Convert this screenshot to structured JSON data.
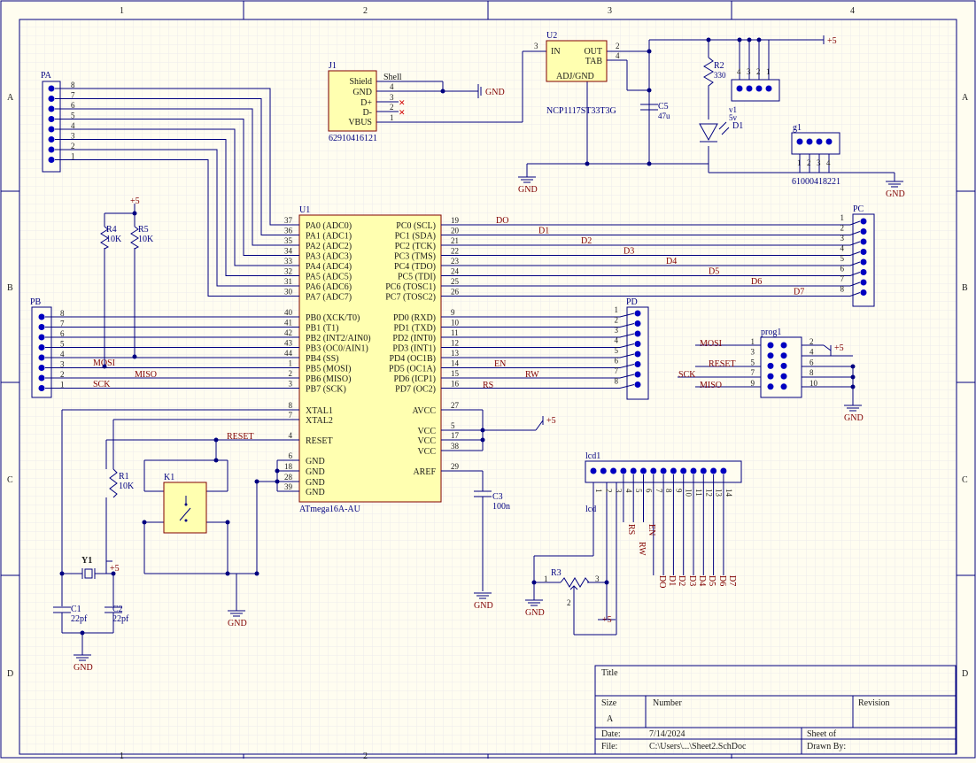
{
  "colors": {
    "wire": "#000080",
    "text": "#000080",
    "netlabel": "#800000",
    "chipfill": "#ffffb0",
    "chipstroke": "#800000",
    "grid": "#e8e8e8",
    "paper": "#fffdf0"
  },
  "border": {
    "cols": [
      "1",
      "2",
      "3",
      "4"
    ],
    "rows": [
      "A",
      "B",
      "C",
      "D"
    ]
  },
  "pa": {
    "ref": "PA",
    "pins": [
      "8",
      "7",
      "6",
      "5",
      "4",
      "3",
      "2",
      "1"
    ]
  },
  "pb": {
    "ref": "PB",
    "pins": [
      "8",
      "7",
      "6",
      "5",
      "4",
      "3",
      "2",
      "1"
    ],
    "nets": {
      "mosi": "MOSI",
      "miso": "MISO",
      "sck": "SCK"
    }
  },
  "pc": {
    "ref": "PC",
    "pins": [
      "1",
      "2",
      "3",
      "4",
      "5",
      "6",
      "7",
      "8"
    ],
    "nets": [
      "DO",
      "D1",
      "D2",
      "D3",
      "D4",
      "D5",
      "D6",
      "D7"
    ]
  },
  "pd": {
    "ref": "PD",
    "pins": [
      "1",
      "2",
      "3",
      "4",
      "5",
      "6",
      "7",
      "8"
    ],
    "nets": {
      "en": "EN",
      "rw": "RW",
      "rs": "RS"
    }
  },
  "u1": {
    "ref": "U1",
    "part": "ATmega16A-AU",
    "left_pa": [
      {
        "num": "37",
        "label": "PA0 (ADC0)"
      },
      {
        "num": "36",
        "label": "PA1 (ADC1)"
      },
      {
        "num": "35",
        "label": "PA2 (ADC2)"
      },
      {
        "num": "34",
        "label": "PA3 (ADC3)"
      },
      {
        "num": "33",
        "label": "PA4 (ADC4)"
      },
      {
        "num": "32",
        "label": "PA5 (ADC5)"
      },
      {
        "num": "31",
        "label": "PA6 (ADC6)"
      },
      {
        "num": "30",
        "label": "PA7 (ADC7)"
      }
    ],
    "left_pb": [
      {
        "num": "40",
        "label": "PB0 (XCK/T0)"
      },
      {
        "num": "41",
        "label": "PB1 (T1)"
      },
      {
        "num": "42",
        "label": "PB2 (INT2/AIN0)"
      },
      {
        "num": "43",
        "label": "PB3 (OC0/AIN1)"
      },
      {
        "num": "44",
        "label": "PB4 (SS)"
      },
      {
        "num": "1",
        "label": "PB5 (MOSI)"
      },
      {
        "num": "2",
        "label": "PB6 (MISO)"
      },
      {
        "num": "3",
        "label": "PB7 (SCK)"
      }
    ],
    "left_misc": [
      {
        "num": "8",
        "label": "XTAL1"
      },
      {
        "num": "7",
        "label": "XTAL2"
      },
      {
        "num": "4",
        "label": "RESET"
      },
      {
        "num": "6",
        "label": "GND"
      },
      {
        "num": "18",
        "label": "GND"
      },
      {
        "num": "28",
        "label": "GND"
      },
      {
        "num": "39",
        "label": "GND"
      }
    ],
    "right_pc": [
      {
        "num": "19",
        "label": "PC0 (SCL)"
      },
      {
        "num": "20",
        "label": "PC1 (SDA)"
      },
      {
        "num": "21",
        "label": "PC2 (TCK)"
      },
      {
        "num": "22",
        "label": "PC3 (TMS)"
      },
      {
        "num": "23",
        "label": "PC4 (TDO)"
      },
      {
        "num": "24",
        "label": "PC5 (TDI)"
      },
      {
        "num": "25",
        "label": "PC6 (TOSC1)"
      },
      {
        "num": "26",
        "label": "PC7 (TOSC2)"
      }
    ],
    "right_pd": [
      {
        "num": "9",
        "label": "PD0 (RXD)"
      },
      {
        "num": "10",
        "label": "PD1 (TXD)"
      },
      {
        "num": "11",
        "label": "PD2 (INT0)"
      },
      {
        "num": "12",
        "label": "PD3 (INT1)"
      },
      {
        "num": "13",
        "label": "PD4 (OC1B)"
      },
      {
        "num": "14",
        "label": "PD5 (OC1A)"
      },
      {
        "num": "15",
        "label": "PD6 (ICP1)"
      },
      {
        "num": "16",
        "label": "PD7 (OC2)"
      }
    ],
    "right_misc": [
      {
        "num": "27",
        "label": "AVCC"
      },
      {
        "num": "5",
        "label": "VCC"
      },
      {
        "num": "17",
        "label": "VCC"
      },
      {
        "num": "38",
        "label": "VCC"
      },
      {
        "num": "29",
        "label": "AREF"
      }
    ]
  },
  "j1": {
    "ref": "J1",
    "part": "62910416121",
    "pins": [
      {
        "label": "Shield",
        "num": "4"
      },
      {
        "label": "GND",
        "num": "3"
      },
      {
        "label": "D+",
        "num": "2"
      },
      {
        "label": "D-",
        "num": "1"
      },
      {
        "label": "VBUS",
        "num": ""
      }
    ],
    "shell": "Shell"
  },
  "u2": {
    "ref": "U2",
    "part": "NCP1117ST33T3G",
    "in": "IN",
    "out": "OUT",
    "tab": "TAB",
    "adj": "ADJ/GND",
    "pin_in": "3",
    "pin_out": "2",
    "pin_tab": "4",
    "pin_adj": "1"
  },
  "c5": {
    "ref": "C5",
    "value": "47u"
  },
  "r2": {
    "ref": "R2",
    "value": "330"
  },
  "d1": {
    "ref": "D1",
    "value": "v1",
    "color": "5v"
  },
  "g1": {
    "ref": "g1",
    "part": "61000418221",
    "pins": [
      "1",
      "2",
      "3",
      "4"
    ]
  },
  "pwr_hdr": {
    "pins": [
      "4",
      "3",
      "2",
      "1"
    ]
  },
  "r4": {
    "ref": "R4",
    "value": "10K",
    "ghost": "R4"
  },
  "r5": {
    "ref": "R5",
    "value": "10K",
    "ghost": "R5"
  },
  "r1": {
    "ref": "R1",
    "value": "10K"
  },
  "k1": {
    "ref": "K1"
  },
  "y1": {
    "ref": "Y1"
  },
  "c1": {
    "ref": "C1",
    "value": "22pf"
  },
  "c2": {
    "ref": "C2",
    "value": "22pf"
  },
  "c3": {
    "ref": "C3",
    "value": "100n"
  },
  "r3": {
    "ref": "R3"
  },
  "prog1": {
    "ref": "prog1",
    "left": [
      "1",
      "3",
      "5",
      "7",
      "9"
    ],
    "right": [
      "2",
      "4",
      "6",
      "8",
      "10"
    ],
    "nets": [
      "MOSI",
      "",
      "RESET",
      "SCK",
      "MISO"
    ]
  },
  "lcd": {
    "ref": "lcd1",
    "label": "lcd",
    "pins": [
      "1",
      "2",
      "3",
      "4",
      "5",
      "6",
      "7",
      "8",
      "9",
      "10",
      "11",
      "12",
      "13",
      "14"
    ],
    "nets": [
      "RS",
      "RW",
      "EN",
      "DO",
      "D1",
      "D2",
      "D3",
      "D4",
      "D5",
      "D6",
      "D7"
    ]
  },
  "power": {
    "vcc": "+5",
    "gnd": "GND",
    "reset": "RESET"
  },
  "title_block": {
    "title": "Title",
    "size_label": "Size",
    "size": "A",
    "number_label": "Number",
    "revision_label": "Revision",
    "date_label": "Date:",
    "date": "7/14/2024",
    "file_label": "File:",
    "file": "C:\\Users\\...\\Sheet2.SchDoc",
    "sheet_label": "Sheet  of",
    "drawn_label": "Drawn By:"
  }
}
